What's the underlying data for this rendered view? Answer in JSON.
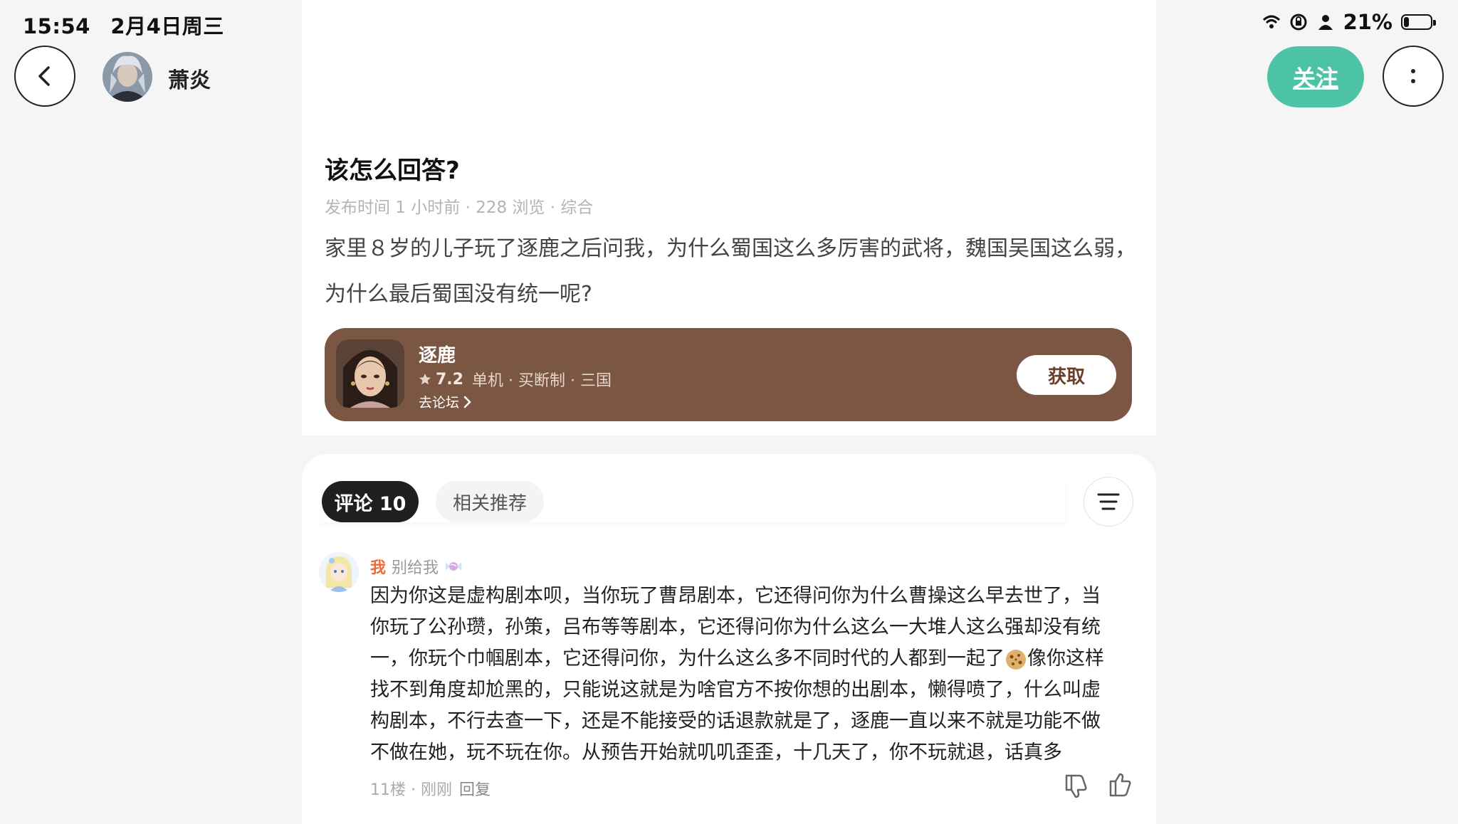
{
  "status_bar": {
    "time": "15:54",
    "date": "2月4日周三",
    "battery": "21%",
    "battery_level": 0.21
  },
  "header": {
    "author_name": "萧炎",
    "follow_label": "关注"
  },
  "post": {
    "title": "该怎么回答?",
    "meta": "发布时间 1 小时前 · 228 浏览 · 综合",
    "content": "家里８岁的儿子玩了逐鹿之后问我，为什么蜀国这么多厉害的武将，魏国吴国这么弱，为什么最后蜀国没有统一呢?"
  },
  "game_card": {
    "name": "逐鹿",
    "rating": "7.2",
    "tags": "单机 · 买断制 · 三国",
    "forum_label": "去论坛",
    "get_label": "获取"
  },
  "comments_section": {
    "tab_comments": "评论 10",
    "tab_related": "相关推荐",
    "comment": {
      "me_tag": "我",
      "username": "别给我",
      "lines": [
        "因为你这是虚构剧本呗，当你玩了曹昂剧本，它还得问你为什么曹操这么早去世了，当",
        "你玩了公孙瓒，孙策，吕布等等剧本，它还得问你为什么这么一大堆人这么强却没有统",
        "一，你玩个巾帼剧本，它还得问你，为什么这么多不同时代的人都到一起了",
        "像你这样",
        "找不到角度却尬黑的，只能说这就是为啥官方不按你想的出剧本，懒得喷了，什么叫虚",
        "构剧本，不行去查一下，还是不能接受的话退款就是了，逐鹿一直以来不就是功能不做",
        "不做在她，玩不玩在你。从预告开始就叽叽歪歪，十几天了，你不玩就退，话真多"
      ],
      "floor_time": "11楼 · 刚刚",
      "reply_label": "回复"
    }
  }
}
